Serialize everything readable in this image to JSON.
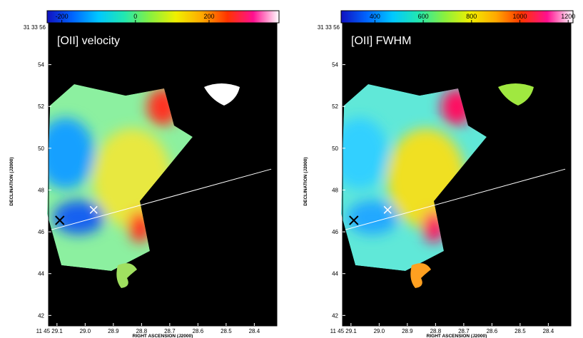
{
  "panels": [
    {
      "id": "velocity",
      "overlay_title": "[OII] velocity",
      "colorbar": {
        "ticks": [
          {
            "v": -200,
            "label": "-200"
          },
          {
            "v": 0,
            "label": "0"
          },
          {
            "v": 200,
            "label": "200"
          }
        ],
        "range": [
          -240,
          390
        ],
        "colors": [
          "#1010c0",
          "#0066ff",
          "#00c8ff",
          "#22e8b0",
          "#88f040",
          "#f0f000",
          "#ffaa00",
          "#ff3300",
          "#ff1090",
          "#ffffff"
        ]
      },
      "fill_colors": {
        "body": "#8cf0a0",
        "cool": "#18a0ff",
        "deep": "#1860f0",
        "warm": "#e8e840",
        "hot": "#ff3020",
        "cloud": "#ffffff",
        "knot": "#a0e060"
      },
      "cross_colors": {
        "black": "#000000",
        "white": "#ffffff"
      }
    },
    {
      "id": "fwhm",
      "overlay_title": "[OII]  FWHM",
      "colorbar": {
        "ticks": [
          {
            "v": 400,
            "label": "400"
          },
          {
            "v": 600,
            "label": "600"
          },
          {
            "v": 800,
            "label": "800"
          },
          {
            "v": 1000,
            "label": "1000"
          },
          {
            "v": 1200,
            "label": "1200"
          }
        ],
        "range": [
          260,
          1220
        ],
        "colors": [
          "#1010c0",
          "#0066ff",
          "#00c8ff",
          "#22e8b0",
          "#88f040",
          "#f0f000",
          "#ffaa00",
          "#ff3300",
          "#ff1090",
          "#ffffff"
        ]
      },
      "fill_colors": {
        "body": "#60e8d8",
        "cool": "#30d0ff",
        "deep": "#20a8ff",
        "warm": "#f0e020",
        "hot": "#ff1060",
        "cloud": "#a0e840",
        "knot": "#ffa020"
      },
      "cross_colors": {
        "black": "#000000",
        "white": "#ffffff"
      }
    }
  ],
  "axes": {
    "dec_top_label": "31 33 56",
    "dec_ticks": [
      {
        "v": 54,
        "label": "54"
      },
      {
        "v": 52,
        "label": "52"
      },
      {
        "v": 50,
        "label": "50"
      },
      {
        "v": 48,
        "label": "48"
      },
      {
        "v": 46,
        "label": "46"
      },
      {
        "v": 44,
        "label": "44"
      },
      {
        "v": 42,
        "label": "42"
      }
    ],
    "ra_first_label": "11 45 29.1",
    "ra_ticks": [
      {
        "v": 29.0,
        "label": "29.0"
      },
      {
        "v": 28.9,
        "label": "28.9"
      },
      {
        "v": 28.8,
        "label": "28.8"
      },
      {
        "v": 28.7,
        "label": "28.7"
      },
      {
        "v": 28.6,
        "label": "28.6"
      },
      {
        "v": 28.5,
        "label": "28.5"
      },
      {
        "v": 28.4,
        "label": "28.4"
      }
    ],
    "xlabel": "RIGHT ASCENSION (J2000)",
    "ylabel": "DECLINATION (J2000)"
  },
  "chart_data": [
    {
      "type": "heatmap",
      "title": "[OII] velocity",
      "xlabel": "RIGHT ASCENSION (J2000)",
      "ylabel": "DECLINATION (J2000)",
      "x_ticks": [
        "11 45 29.1",
        "29.0",
        "28.9",
        "28.8",
        "28.7",
        "28.6",
        "28.5",
        "28.4"
      ],
      "y_ticks": [
        "31 33 56",
        "54",
        "52",
        "50",
        "48",
        "46",
        "44",
        "42"
      ],
      "colorbar_ticks": [
        -200,
        0,
        200
      ],
      "xlim": [
        29.13,
        28.32
      ],
      "ylim": [
        41.5,
        56.0
      ],
      "grid": false,
      "markers": [
        {
          "symbol": "X",
          "color": "black",
          "x": 29.09,
          "y": 46.55
        },
        {
          "symbol": "X",
          "color": "white",
          "x": 28.97,
          "y": 47.05
        }
      ],
      "slit_line": {
        "from": [
          29.12,
          46.1
        ],
        "to": [
          28.34,
          49.0
        ]
      }
    },
    {
      "type": "heatmap",
      "title": "[OII]  FWHM",
      "xlabel": "RIGHT ASCENSION (J2000)",
      "ylabel": "DECLINATION (J2000)",
      "x_ticks": [
        "11 45 29.1",
        "29.0",
        "28.9",
        "28.8",
        "28.7",
        "28.6",
        "28.5",
        "28.4"
      ],
      "y_ticks": [
        "31 33 56",
        "54",
        "52",
        "50",
        "48",
        "46",
        "44",
        "42"
      ],
      "colorbar_ticks": [
        400,
        600,
        800,
        1000,
        1200
      ],
      "xlim": [
        29.13,
        28.32
      ],
      "ylim": [
        41.5,
        56.0
      ],
      "grid": false,
      "markers": [
        {
          "symbol": "X",
          "color": "black",
          "x": 29.09,
          "y": 46.55
        },
        {
          "symbol": "X",
          "color": "white",
          "x": 28.97,
          "y": 47.05
        }
      ],
      "slit_line": {
        "from": [
          29.12,
          46.1
        ],
        "to": [
          28.34,
          49.0
        ]
      }
    }
  ]
}
